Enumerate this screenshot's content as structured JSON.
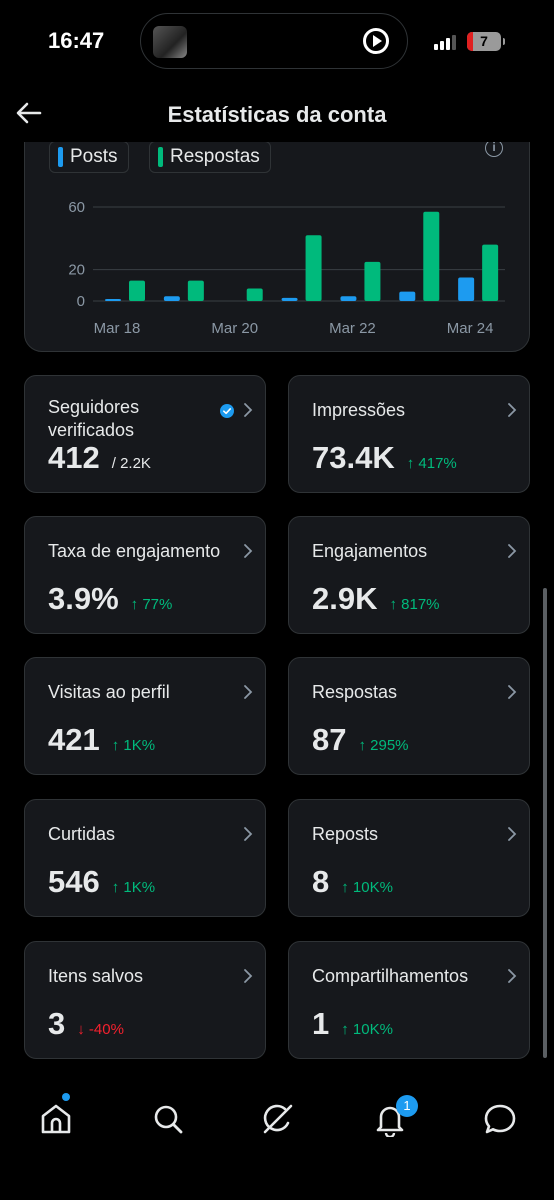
{
  "status_bar": {
    "time": "16:47",
    "battery": "7"
  },
  "header": {
    "title": "Estatísticas da conta"
  },
  "chart_data": {
    "type": "bar",
    "title": "",
    "series": [
      {
        "name": "Posts",
        "color": "#1d9bf0",
        "values": [
          1,
          3,
          0,
          2,
          3,
          6,
          15
        ]
      },
      {
        "name": "Respostas",
        "color": "#00ba7c",
        "values": [
          13,
          13,
          8,
          42,
          25,
          57,
          36
        ]
      }
    ],
    "categories": [
      "Mar 18",
      "Mar 19",
      "Mar 20",
      "Mar 21",
      "Mar 22",
      "Mar 23",
      "Mar 24"
    ],
    "x_tick_labels": [
      "Mar 18",
      "Mar 20",
      "Mar 22",
      "Mar 24"
    ],
    "y_ticks": [
      "0",
      "20",
      "60"
    ],
    "ylim": [
      0,
      60
    ],
    "grid": true,
    "legend_position": "top-left"
  },
  "stats": [
    {
      "label": "Seguidores verificados",
      "value": "412",
      "sub": "/ 2.2K",
      "delta": "",
      "direction": "none",
      "verified": true
    },
    {
      "label": "Impressões",
      "value": "73.4K",
      "sub": "",
      "delta": "↑ 417%",
      "direction": "up"
    },
    {
      "label": "Taxa de engajamento",
      "value": "3.9%",
      "sub": "",
      "delta": "↑ 77%",
      "direction": "up"
    },
    {
      "label": "Engajamentos",
      "value": "2.9K",
      "sub": "",
      "delta": "↑ 817%",
      "direction": "up"
    },
    {
      "label": "Visitas ao perfil",
      "value": "421",
      "sub": "",
      "delta": "↑ 1K%",
      "direction": "up"
    },
    {
      "label": "Respostas",
      "value": "87",
      "sub": "",
      "delta": "↑ 295%",
      "direction": "up"
    },
    {
      "label": "Curtidas",
      "value": "546",
      "sub": "",
      "delta": "↑ 1K%",
      "direction": "up"
    },
    {
      "label": "Reposts",
      "value": "8",
      "sub": "",
      "delta": "↑ 10K%",
      "direction": "up"
    },
    {
      "label": "Itens salvos",
      "value": "3",
      "sub": "",
      "delta": "↓ -40%",
      "direction": "down"
    },
    {
      "label": "Compartilhamentos",
      "value": "1",
      "sub": "",
      "delta": "↑ 10K%",
      "direction": "up"
    }
  ],
  "bottom_nav": {
    "items": [
      "home-icon",
      "search-icon",
      "grok-icon",
      "notifications-icon",
      "messages-icon"
    ],
    "notification_count": "1"
  }
}
